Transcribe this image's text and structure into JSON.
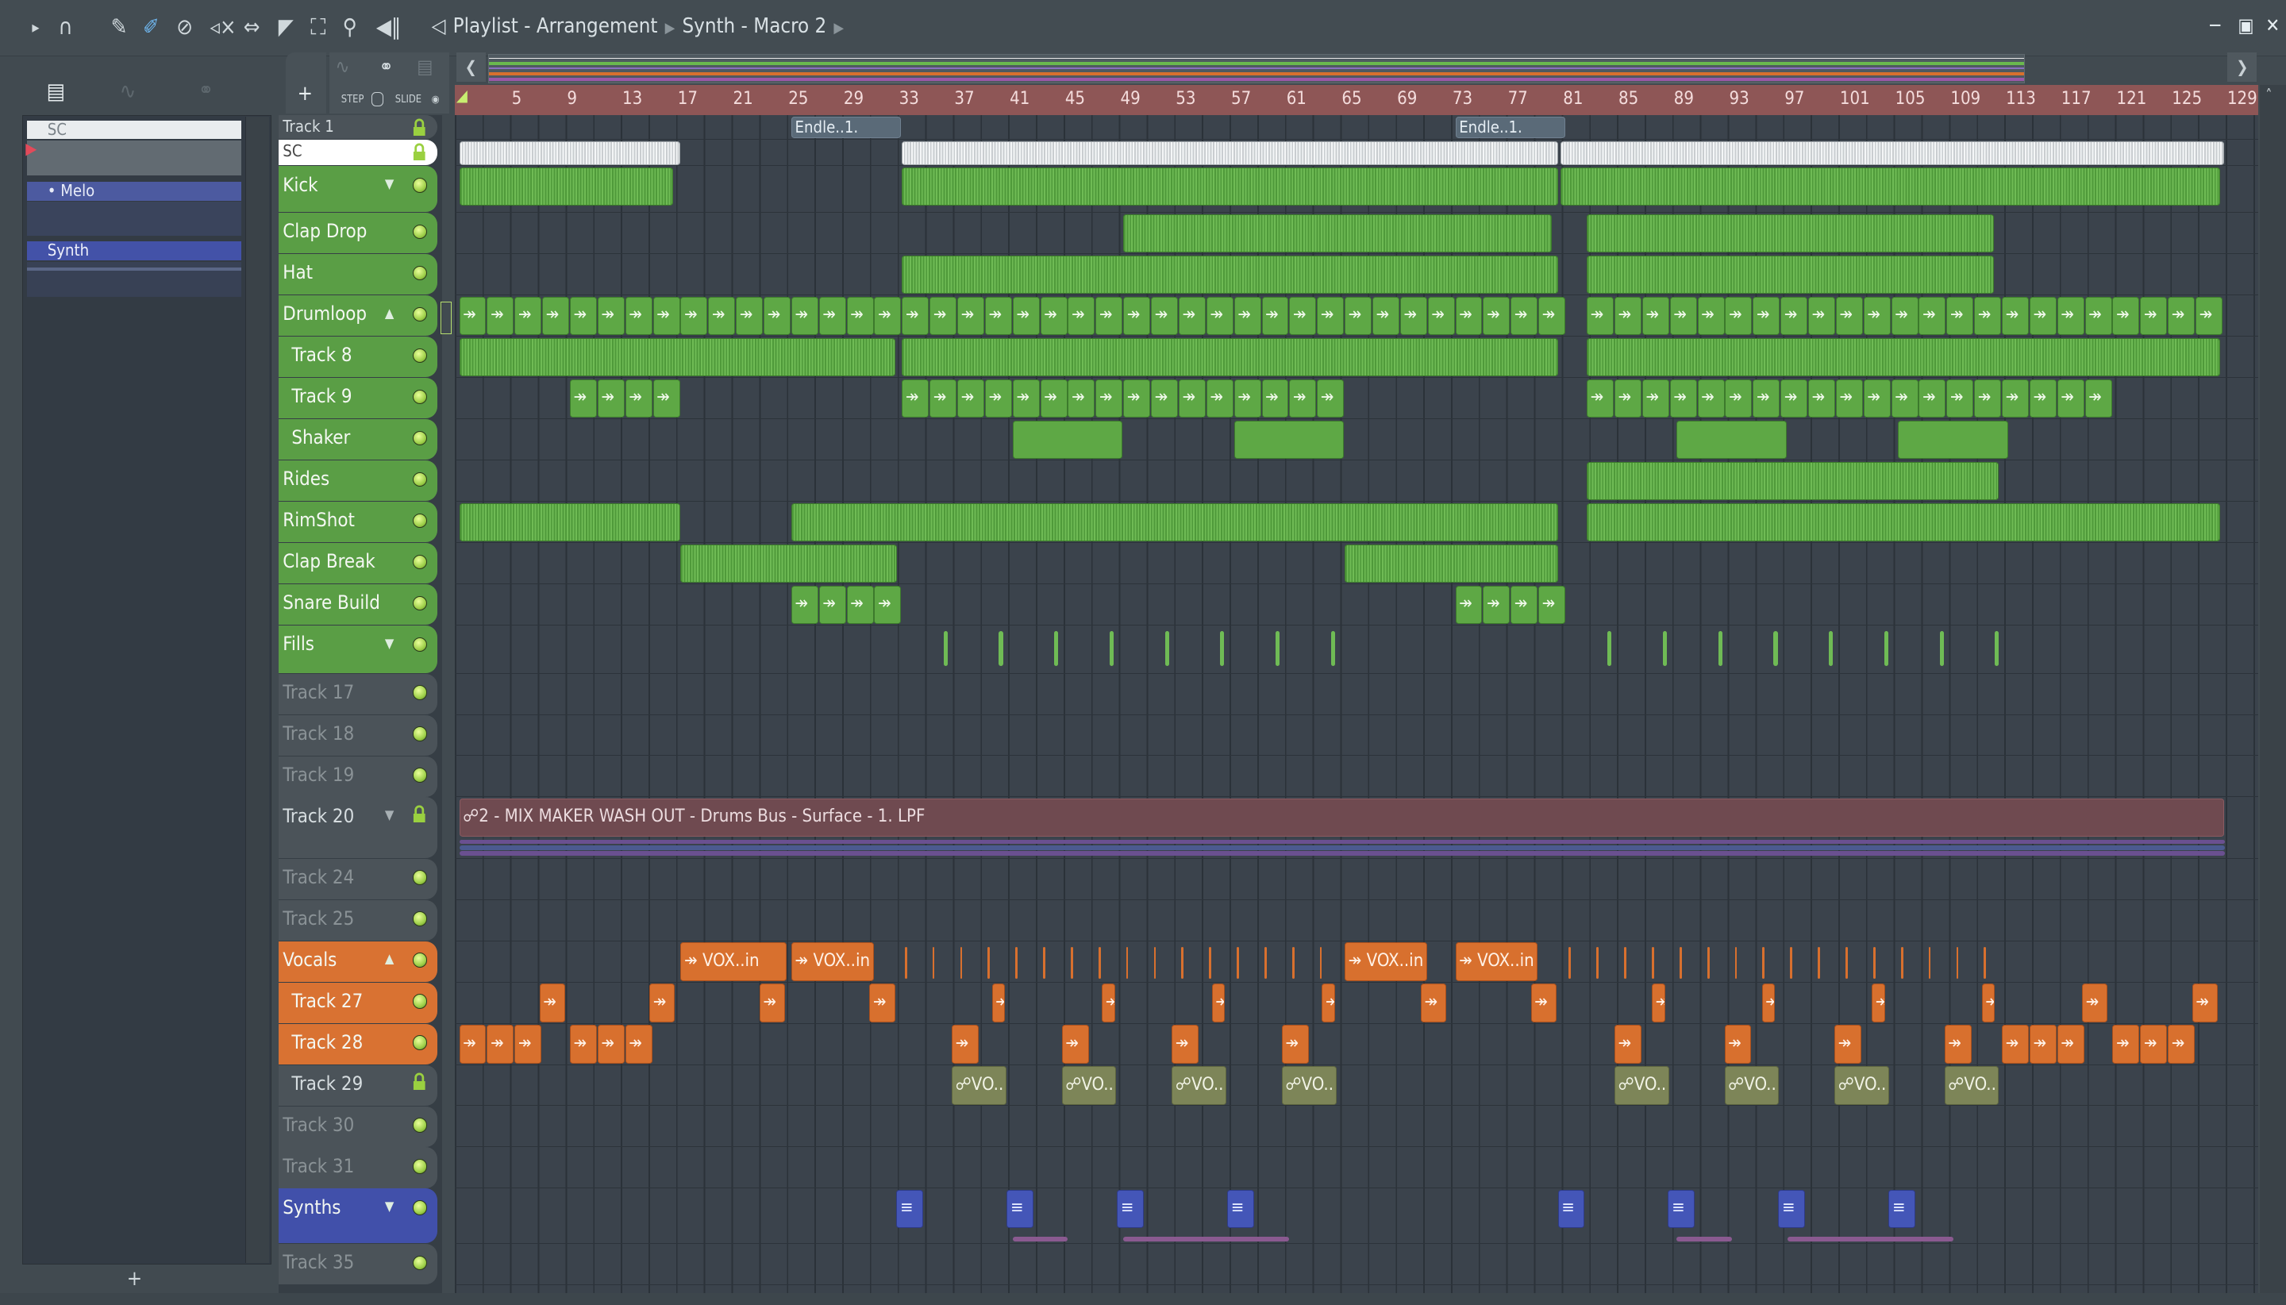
{
  "toolbar": {
    "icons": [
      "play-arrow-icon",
      "magnet-icon",
      "pencil-icon",
      "paint-brush-icon",
      "delete-icon",
      "mute-icon",
      "slip-icon",
      "slice-icon",
      "select-icon",
      "zoom-icon",
      "playback-icon",
      "speaker-icon"
    ],
    "title": "Playlist - Arrangement",
    "subtitle": "Synth - Macro 2",
    "step_label": "STEP",
    "slide_label": "SLIDE",
    "add_label": "+"
  },
  "picker": {
    "items": [
      {
        "label": "SC"
      },
      {
        "label": "Melo"
      },
      {
        "label": "Synth"
      }
    ],
    "add_label": "+"
  },
  "ruler": {
    "labels": [
      "5",
      "9",
      "13",
      "17",
      "21",
      "25",
      "29",
      "33",
      "37",
      "41",
      "45",
      "49",
      "53",
      "57",
      "61",
      "65",
      "69",
      "73",
      "77",
      "81",
      "85",
      "89",
      "93",
      "97",
      "101",
      "105",
      "109",
      "113",
      "117",
      "121",
      "125",
      "129"
    ]
  },
  "colors": {
    "green": "#5ea845",
    "orange": "#d8702e",
    "blue": "#4456b8",
    "gray": "#4a5157",
    "ruler": "#8e5656"
  },
  "tracks": [
    {
      "name": "Track 1",
      "top": 0,
      "h": 17,
      "color": "gray",
      "lock": true,
      "dim": false,
      "clips": [
        {
          "s": 25,
          "l": 8,
          "t": "Endle..1.",
          "c": "endle"
        },
        {
          "s": 73,
          "l": 8,
          "t": "Endle..1.",
          "c": "endle"
        }
      ]
    },
    {
      "name": "SC",
      "color": "white",
      "lock": true,
      "clips": [
        {
          "s": 1,
          "l": 16,
          "c": "white"
        },
        {
          "s": 33,
          "l": 47.5,
          "c": "white"
        },
        {
          "s": 80.6,
          "l": 48,
          "c": "white"
        }
      ]
    },
    {
      "name": "Kick",
      "color": "green",
      "arrow": "down",
      "tall": true,
      "clips": [
        {
          "s": 1,
          "l": 15.5,
          "c": "wave"
        },
        {
          "s": 33,
          "l": 47.5,
          "c": "wave"
        },
        {
          "s": 80.6,
          "l": 47.7,
          "c": "wave"
        }
      ]
    },
    {
      "name": "Clap Drop",
      "color": "green",
      "clips": [
        {
          "s": 49,
          "l": 31,
          "c": "wave"
        },
        {
          "s": 82.5,
          "l": 29.5,
          "c": "wave"
        }
      ]
    },
    {
      "name": "Hat",
      "color": "green",
      "clips": [
        {
          "s": 33,
          "l": 47.5,
          "c": "wave"
        },
        {
          "s": 82.5,
          "l": 29.5,
          "c": "wave"
        }
      ]
    },
    {
      "name": "Drumloop",
      "color": "green",
      "arrow": "up",
      "clips": [
        {
          "s": 1,
          "l": 2,
          "n": 16,
          "c": "green",
          "t": "↠"
        },
        {
          "s": 33,
          "l": 2,
          "n": 8,
          "c": "green",
          "t": "↠"
        },
        {
          "s": 49,
          "l": 2,
          "n": 16,
          "c": "green",
          "t": "↠"
        },
        {
          "s": 82.5,
          "l": 2,
          "n": 23,
          "c": "green",
          "t": "↠"
        }
      ]
    },
    {
      "name": "Track 8",
      "color": "green",
      "child": true,
      "clips": [
        {
          "s": 1,
          "l": 31.6,
          "c": "wave"
        },
        {
          "s": 33,
          "l": 47.5,
          "c": "wave"
        },
        {
          "s": 82.5,
          "l": 45.8,
          "c": "wave"
        }
      ]
    },
    {
      "name": "Track 9",
      "color": "green",
      "child": true,
      "clips": [
        {
          "s": 9,
          "l": 2,
          "n": 4,
          "c": "green",
          "t": "↠"
        },
        {
          "s": 33,
          "l": 2,
          "n": 16,
          "c": "green",
          "t": "↠"
        },
        {
          "s": 82.5,
          "l": 2,
          "n": 19,
          "c": "green",
          "t": "↠"
        }
      ]
    },
    {
      "name": "Shaker",
      "color": "green",
      "child": true,
      "clips": [
        {
          "s": 41,
          "l": 8,
          "c": "green"
        },
        {
          "s": 57,
          "l": 8,
          "c": "green"
        },
        {
          "s": 89,
          "l": 8,
          "c": "green"
        },
        {
          "s": 105,
          "l": 8,
          "c": "green"
        }
      ]
    },
    {
      "name": "Rides",
      "color": "green",
      "clips": [
        {
          "s": 82.5,
          "l": 29.8,
          "c": "wave"
        }
      ]
    },
    {
      "name": "RimShot",
      "color": "green",
      "clips": [
        {
          "s": 1,
          "l": 16,
          "c": "wave"
        },
        {
          "s": 25,
          "l": 55.5,
          "c": "wave"
        },
        {
          "s": 82.5,
          "l": 45.8,
          "c": "wave"
        }
      ]
    },
    {
      "name": "Clap Break",
      "color": "green",
      "clips": [
        {
          "s": 17,
          "l": 15.7,
          "c": "wave"
        },
        {
          "s": 65,
          "l": 15.5,
          "c": "wave"
        }
      ]
    },
    {
      "name": "Snare Build",
      "color": "green",
      "clips": [
        {
          "s": 25,
          "l": 2,
          "n": 4,
          "c": "green",
          "t": "↠"
        },
        {
          "s": 73,
          "l": 2,
          "n": 4,
          "c": "green",
          "t": "↠"
        }
      ]
    },
    {
      "name": "Fills",
      "color": "green",
      "arrow": "down",
      "tall": true,
      "clips": [
        {
          "s": 36,
          "l": 0.35,
          "n": 8,
          "e": 4,
          "c": "tick"
        },
        {
          "s": 84,
          "l": 0.35,
          "n": 8,
          "e": 4,
          "c": "tick"
        }
      ]
    },
    {
      "name": "Track 17",
      "color": "gray",
      "dim": true,
      "clips": []
    },
    {
      "name": "Track 18",
      "color": "gray",
      "dim": true,
      "clips": []
    },
    {
      "name": "Track 19",
      "color": "gray",
      "dim": true,
      "clips": []
    },
    {
      "name": "Track 20",
      "color": "gray",
      "lock": true,
      "arrow": "down",
      "auto": true,
      "clips": [
        {
          "s": 1,
          "l": 127.6,
          "c": "auto",
          "t": "☍2 - MIX MAKER WASH OUT - Drums Bus - Surface - 1. LPF"
        }
      ]
    },
    {
      "name": "Track 24",
      "color": "gray",
      "dim": true,
      "clips": []
    },
    {
      "name": "Track 25",
      "color": "gray",
      "dim": true,
      "clips": []
    },
    {
      "name": "Vocals",
      "color": "orange",
      "arrow": "up",
      "clips": [
        {
          "s": 17,
          "l": 7.7,
          "c": "orange",
          "t": "↠ VOX..in"
        },
        {
          "s": 25,
          "l": 6,
          "c": "orange",
          "t": "↠ VOX..in"
        },
        {
          "s": 65,
          "l": 6,
          "c": "orange",
          "t": "↠ VOX..in"
        },
        {
          "s": 73,
          "l": 6,
          "c": "orange",
          "t": "↠ VOX..in"
        },
        {
          "s": 33.2,
          "l": 0.2,
          "n": 16,
          "e": 2,
          "c": "otick"
        },
        {
          "s": 81.2,
          "l": 0.2,
          "n": 16,
          "e": 2,
          "c": "otick"
        }
      ]
    },
    {
      "name": "Track 27",
      "color": "orange",
      "child": true,
      "clips": [
        {
          "s": 6.8,
          "l": 1.9,
          "n": 4,
          "e": 7.95,
          "c": "orange",
          "t": "↠"
        },
        {
          "s": 39.5,
          "l": 1,
          "n": 4,
          "e": 7.95,
          "c": "orange",
          "t": "↠"
        },
        {
          "s": 70.5,
          "l": 1.9,
          "n": 2,
          "e": 7.95,
          "c": "orange",
          "t": "↠"
        },
        {
          "s": 87.2,
          "l": 1,
          "n": 4,
          "e": 7.95,
          "c": "orange",
          "t": "↠"
        },
        {
          "s": 118.3,
          "l": 1.9,
          "n": 2,
          "e": 7.95,
          "c": "orange",
          "t": "↠"
        }
      ]
    },
    {
      "name": "Track 28",
      "color": "orange",
      "child": true,
      "clips": [
        {
          "s": 1,
          "l": 2,
          "n": 3,
          "c": "orange",
          "t": "↠"
        },
        {
          "s": 9,
          "l": 2,
          "n": 3,
          "c": "orange",
          "t": "↠"
        },
        {
          "s": 36.6,
          "l": 2,
          "n": 4,
          "e": 7.95,
          "c": "orange",
          "t": "↠"
        },
        {
          "s": 84.5,
          "l": 2,
          "n": 4,
          "e": 7.95,
          "c": "orange",
          "t": "↠"
        },
        {
          "s": 112.5,
          "l": 2,
          "n": 3,
          "c": "orange",
          "t": "↠"
        },
        {
          "s": 120.5,
          "l": 2,
          "n": 3,
          "c": "orange",
          "t": "↠"
        }
      ]
    },
    {
      "name": "Track 29",
      "color": "gray",
      "child": true,
      "lock": true,
      "clips": [
        {
          "s": 36.6,
          "l": 4,
          "n": 4,
          "e": 7.95,
          "c": "olive",
          "t": "☍VO.."
        },
        {
          "s": 84.5,
          "l": 4,
          "n": 4,
          "e": 7.95,
          "c": "olive",
          "t": "☍VO.."
        }
      ]
    },
    {
      "name": "Track 30",
      "color": "gray",
      "dim": true,
      "clips": []
    },
    {
      "name": "Track 31",
      "color": "gray",
      "dim": true,
      "clips": []
    },
    {
      "name": "Synths",
      "color": "blue",
      "arrow": "down",
      "tall": true,
      "clips": [
        {
          "s": 32.6,
          "l": 2,
          "n": 4,
          "e": 7.97,
          "c": "blue",
          "t": "≡"
        },
        {
          "s": 80.4,
          "l": 2,
          "n": 4,
          "e": 7.97,
          "c": "blue",
          "t": "≡"
        }
      ]
    },
    {
      "name": "Track 35",
      "color": "gray",
      "dim": true,
      "clips": []
    }
  ]
}
